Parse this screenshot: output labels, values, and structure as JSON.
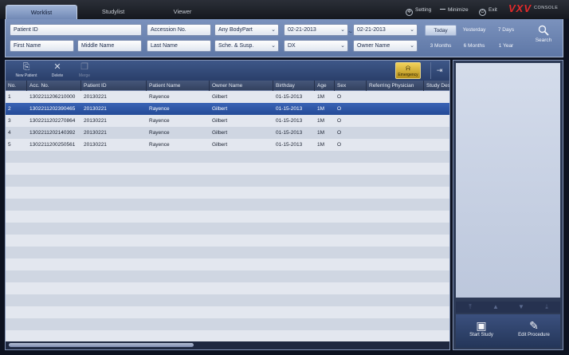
{
  "tabs": [
    {
      "label": "Worklist",
      "active": true
    },
    {
      "label": "Studylist",
      "active": false
    },
    {
      "label": "Viewer",
      "active": false
    }
  ],
  "top_actions": {
    "setting": "Setting",
    "minimize": "Minimize",
    "exit": "Exit"
  },
  "logo": {
    "brand": "VXV",
    "sub": "CONSOLE"
  },
  "filters": {
    "patient_id": "Patient ID",
    "accession_no": "Accession No.",
    "body_part": "Any BodyPart",
    "date_from": "02-21-2013",
    "date_to": "02-21-2013",
    "first_name": "First Name",
    "middle_name": "Middle Name",
    "last_name": "Last Name",
    "schedule": "Sche. & Susp.",
    "modality": "DX",
    "owner_name": "Owner Name"
  },
  "date_ranges": {
    "today": "Today",
    "yesterday": "Yesterday",
    "seven_days": "7 Days",
    "three_months": "3 Months",
    "six_months": "6 Months",
    "one_year": "1 Year",
    "selected": "Today"
  },
  "search_label": "Search",
  "toolbar": {
    "new_patient": "New Patient",
    "delete": "Delete",
    "merge": "Merge",
    "emergency": "Emergency"
  },
  "columns": [
    "No.",
    "Acc. No.",
    "Patient ID",
    "Patient Name",
    "Owner Name",
    "Birthday",
    "Age",
    "Sex",
    "Referring Physician",
    "Study Des"
  ],
  "rows": [
    {
      "no": "1",
      "acc": "1302211206210000",
      "pid": "20130221",
      "pname": "Rayence",
      "owner": "Gilbert",
      "bday": "01-15-2013",
      "age": "1M",
      "sex": "O"
    },
    {
      "no": "2",
      "acc": "1302211202390465",
      "pid": "20130221",
      "pname": "Rayence",
      "owner": "Gilbert",
      "bday": "01-15-2013",
      "age": "1M",
      "sex": "O"
    },
    {
      "no": "3",
      "acc": "1302211202270864",
      "pid": "20130221",
      "pname": "Rayence",
      "owner": "Gilbert",
      "bday": "01-15-2013",
      "age": "1M",
      "sex": "O"
    },
    {
      "no": "4",
      "acc": "1302211202140392",
      "pid": "20130221",
      "pname": "Rayence",
      "owner": "Gilbert",
      "bday": "01-15-2013",
      "age": "1M",
      "sex": "O"
    },
    {
      "no": "5",
      "acc": "1302211200250561",
      "pid": "20130221",
      "pname": "Rayence",
      "owner": "Gilbert",
      "bday": "01-15-2013",
      "age": "1M",
      "sex": "O"
    }
  ],
  "selected_row": 2,
  "side_actions": {
    "start_study": "Start Study",
    "edit_procedure": "Edit Procedure"
  }
}
